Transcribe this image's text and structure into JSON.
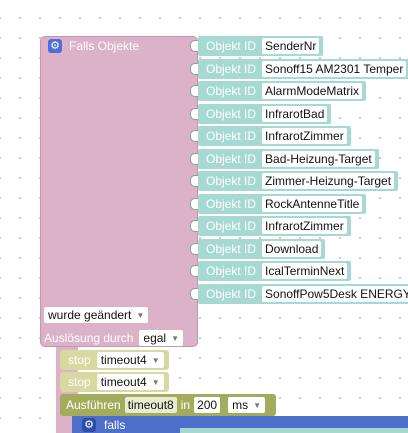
{
  "main_block": {
    "title": "Falls Objekte",
    "trigger_value": "wurde geändert",
    "trigger_label": "Auslösung durch",
    "trigger_mode": "egal"
  },
  "object_label": "Objekt ID",
  "objects": [
    "SenderNr",
    "Sonoff15 AM2301  Temper",
    "AlarmModeMatrix",
    "InfrarotBad",
    "InfrarotZimmer",
    "Bad-Heizung-Target",
    "Zimmer-Heizung-Target",
    "RockAntenneTitle",
    "InfrarotZimmer",
    "Download",
    "IcalTerminNext",
    "SonoffPow5Desk ENERGY"
  ],
  "stops": [
    {
      "keyword": "stop",
      "value": "timeout4"
    },
    {
      "keyword": "stop",
      "value": "timeout4"
    }
  ],
  "execute": {
    "label": "Ausführen",
    "timer": "timeout8",
    "in_label": "in",
    "delay": "200",
    "unit": "ms"
  },
  "if_block": {
    "label": "falls"
  }
}
